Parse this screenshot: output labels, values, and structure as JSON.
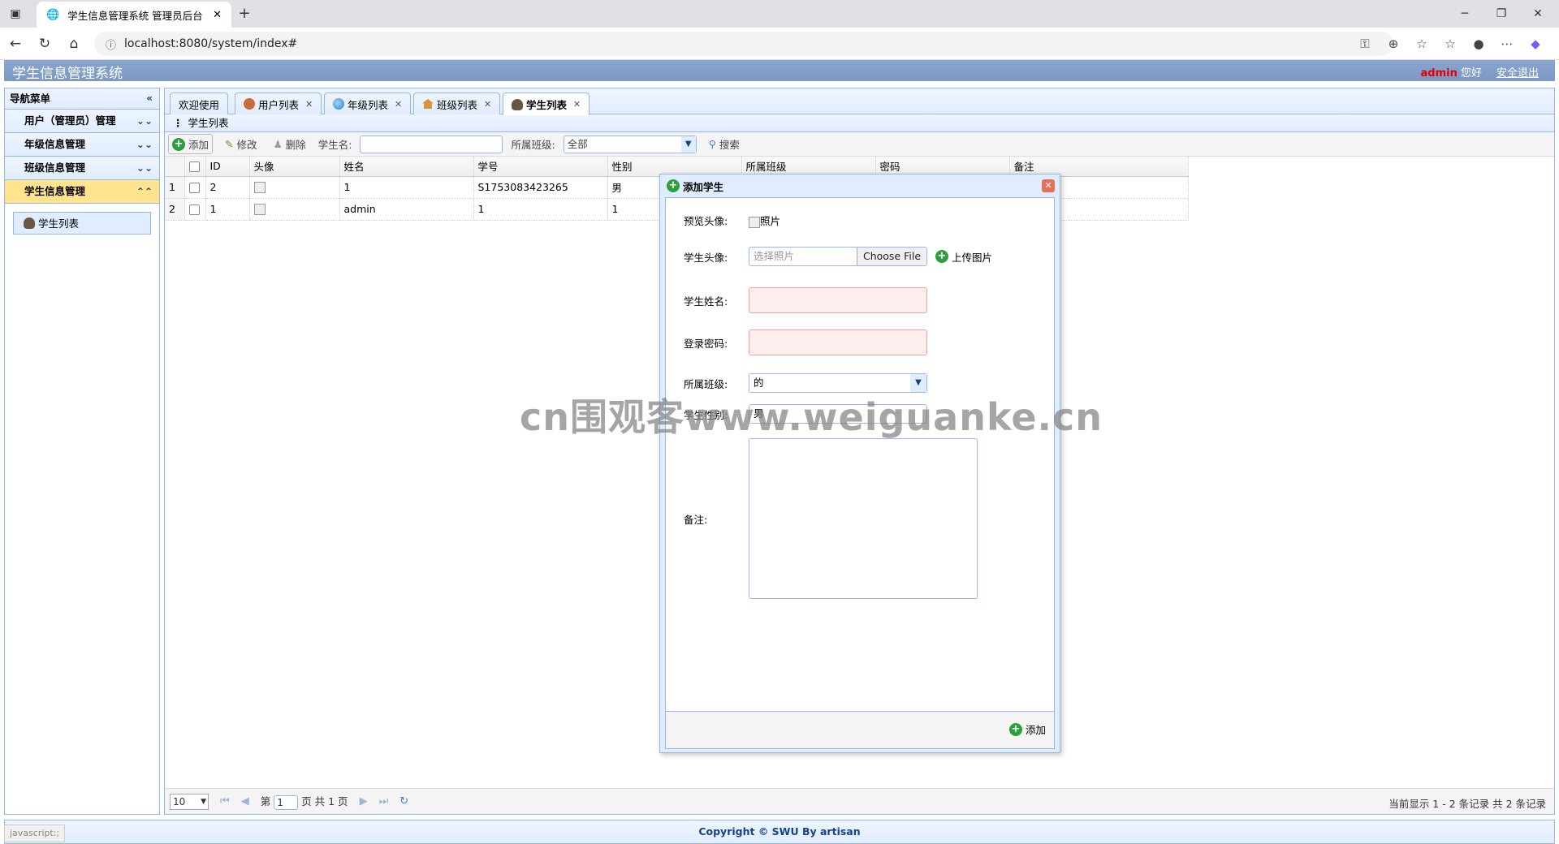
{
  "browser": {
    "tab_title": "学生信息管理系统 管理员后台",
    "url": "localhost:8080/system/index#",
    "new_tab_label": "+"
  },
  "app": {
    "title": "学生信息管理系统",
    "username": "admin",
    "greeting": "您好",
    "logout": "安全退出",
    "footer": "Copyright © SWU By artisan",
    "status_text": "javascript:;",
    "watermark": "cn围观客www.weiguanke.cn"
  },
  "sidebar": {
    "header": "导航菜单",
    "items": [
      {
        "label": "用户（管理员）管理"
      },
      {
        "label": "年级信息管理"
      },
      {
        "label": "班级信息管理"
      },
      {
        "label": "学生信息管理"
      }
    ],
    "sub_items": [
      {
        "label": "学生列表"
      }
    ]
  },
  "tabs": [
    {
      "label": "欢迎使用"
    },
    {
      "label": "用户列表"
    },
    {
      "label": "年级列表"
    },
    {
      "label": "班级列表"
    },
    {
      "label": "学生列表"
    }
  ],
  "panel": {
    "title": "学生列表"
  },
  "toolbar": {
    "add": "添加",
    "edit": "修改",
    "delete": "删除",
    "name_label": "学生名:",
    "class_label": "所属班级:",
    "class_value": "全部",
    "search": "搜索"
  },
  "grid": {
    "columns": [
      "ID",
      "头像",
      "姓名",
      "学号",
      "性别",
      "所属班级",
      "密码",
      "备注"
    ],
    "rows": [
      {
        "rn": "1",
        "id": "2",
        "name": "1",
        "sn": "S1753083423265",
        "sex": "男"
      },
      {
        "rn": "2",
        "id": "1",
        "name": "admin",
        "sn": "1",
        "sex": "1"
      }
    ]
  },
  "pager": {
    "page_size": "10",
    "page_prefix": "第",
    "page_value": "1",
    "page_suffix": "页 共 1 页",
    "info": "当前显示 1 - 2 条记录 共 2 条记录"
  },
  "dialog": {
    "title": "添加学生",
    "preview_label": "预览头像:",
    "preview_alt": "照片",
    "photo_label": "学生头像:",
    "photo_placeholder": "选择照片",
    "choose_file": "Choose File",
    "upload": "上传图片",
    "name_label": "学生姓名:",
    "password_label": "登录密码:",
    "class_label": "所属班级:",
    "class_value": "的",
    "sex_label": "学生性别:",
    "sex_value": "男",
    "remark_label": "备注:",
    "submit": "添加"
  }
}
